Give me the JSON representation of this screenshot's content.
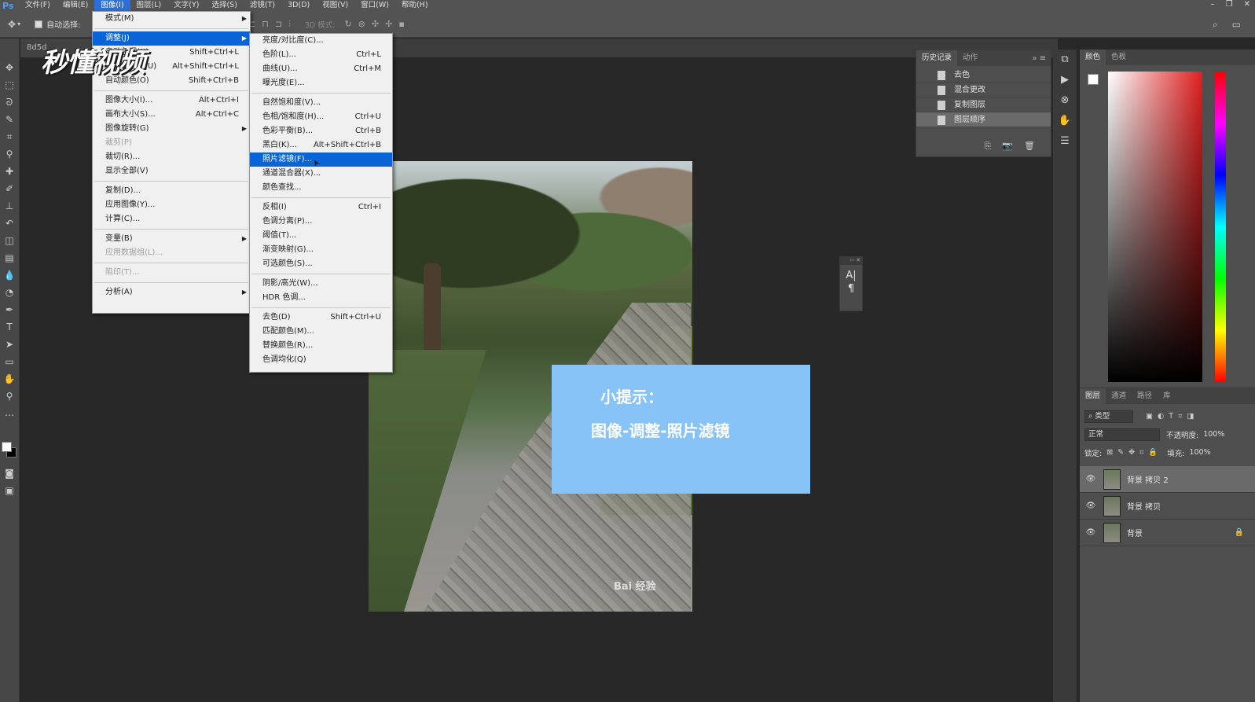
{
  "menubar": {
    "logo": "Ps",
    "items": [
      "文件(F)",
      "编辑(E)",
      "图像(I)",
      "图层(L)",
      "文字(Y)",
      "选择(S)",
      "滤镜(T)",
      "3D(D)",
      "视图(V)",
      "窗口(W)",
      "帮助(H)"
    ],
    "active_index": 2
  },
  "optbar": {
    "auto_select_label": "自动选择:",
    "mode3d_label": "3D 模式:"
  },
  "doc_tab": "8d5d",
  "logo_text": "秒懂视频",
  "image_menu": [
    {
      "label": "模式(M)",
      "arrow": true
    },
    {
      "sep": true
    },
    {
      "label": "调整(J)",
      "arrow": true,
      "highlight": true
    },
    {
      "label": "自动色调(N)",
      "shortcut": "Shift+Ctrl+L"
    },
    {
      "label": "自动对比度(U)",
      "shortcut": "Alt+Shift+Ctrl+L"
    },
    {
      "label": "自动颜色(O)",
      "shortcut": "Shift+Ctrl+B"
    },
    {
      "sep": true
    },
    {
      "label": "图像大小(I)...",
      "shortcut": "Alt+Ctrl+I"
    },
    {
      "label": "画布大小(S)...",
      "shortcut": "Alt+Ctrl+C"
    },
    {
      "label": "图像旋转(G)",
      "arrow": true
    },
    {
      "label": "裁剪(P)",
      "disabled": true
    },
    {
      "label": "裁切(R)..."
    },
    {
      "label": "显示全部(V)"
    },
    {
      "sep": true
    },
    {
      "label": "复制(D)..."
    },
    {
      "label": "应用图像(Y)..."
    },
    {
      "label": "计算(C)..."
    },
    {
      "sep": true
    },
    {
      "label": "变量(B)",
      "arrow": true
    },
    {
      "label": "应用数据组(L)...",
      "disabled": true
    },
    {
      "sep": true
    },
    {
      "label": "陷印(T)...",
      "disabled": true
    },
    {
      "sep": true
    },
    {
      "label": "分析(A)",
      "arrow": true
    }
  ],
  "adjust_menu": [
    {
      "label": "亮度/对比度(C)..."
    },
    {
      "label": "色阶(L)...",
      "shortcut": "Ctrl+L"
    },
    {
      "label": "曲线(U)...",
      "shortcut": "Ctrl+M"
    },
    {
      "label": "曝光度(E)..."
    },
    {
      "sep": true
    },
    {
      "label": "自然饱和度(V)..."
    },
    {
      "label": "色相/饱和度(H)...",
      "shortcut": "Ctrl+U"
    },
    {
      "label": "色彩平衡(B)...",
      "shortcut": "Ctrl+B"
    },
    {
      "label": "黑白(K)...",
      "shortcut": "Alt+Shift+Ctrl+B"
    },
    {
      "label": "照片滤镜(F)...",
      "highlight": true
    },
    {
      "label": "通道混合器(X)..."
    },
    {
      "label": "颜色查找..."
    },
    {
      "sep": true
    },
    {
      "label": "反相(I)",
      "shortcut": "Ctrl+I"
    },
    {
      "label": "色调分离(P)..."
    },
    {
      "label": "阈值(T)..."
    },
    {
      "label": "渐变映射(G)..."
    },
    {
      "label": "可选颜色(S)..."
    },
    {
      "sep": true
    },
    {
      "label": "阴影/高光(W)..."
    },
    {
      "label": "HDR 色调..."
    },
    {
      "sep": true
    },
    {
      "label": "去色(D)",
      "shortcut": "Shift+Ctrl+U"
    },
    {
      "label": "匹配颜色(M)..."
    },
    {
      "label": "替换颜色(R)..."
    },
    {
      "label": "色调均化(Q)"
    }
  ],
  "tip": {
    "title": "小提示：",
    "text": "图像-调整-照片滤镜"
  },
  "watermark": "Bai 经验",
  "history": {
    "tabs": [
      "历史记录",
      "动作"
    ],
    "items": [
      "去色",
      "混合更改",
      "复制图层",
      "图层顺序"
    ],
    "selected_index": 3
  },
  "color_panel": {
    "tabs": [
      "颜色",
      "色板"
    ]
  },
  "layers": {
    "tabs": [
      "图层",
      "通道",
      "路径",
      "库"
    ],
    "filter_label": "类型",
    "blend_mode": "正常",
    "opacity_label": "不透明度:",
    "opacity_value": "100%",
    "lock_label": "锁定:",
    "fill_label": "填充:",
    "fill_value": "100%",
    "items": [
      {
        "name": "背景 拷贝 2",
        "selected": true
      },
      {
        "name": "背景 拷贝"
      },
      {
        "name": "背景",
        "locked": true
      }
    ]
  }
}
